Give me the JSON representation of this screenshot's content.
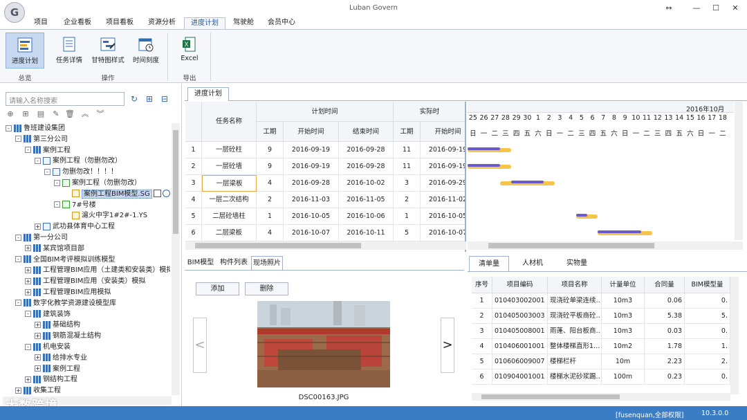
{
  "window": {
    "title": "Luban Govern",
    "logo": "G"
  },
  "menus": [
    "项目",
    "企业看板",
    "项目看板",
    "资源分析",
    "进度计划",
    "驾驶舱",
    "会员中心"
  ],
  "ribbon": {
    "buttons": [
      "进度计划",
      "任务详情",
      "甘特图样式",
      "时间刻度",
      "Excel"
    ],
    "groups": [
      "总览",
      "操作",
      "导出"
    ]
  },
  "left": {
    "search_placeholder": "请输入名称搜索",
    "tree": [
      {
        "label": "鲁班建设集团",
        "level": 0,
        "icon": "org",
        "expand": "-"
      },
      {
        "label": "第三分公司",
        "level": 1,
        "icon": "org",
        "expand": "-"
      },
      {
        "label": "案例工程",
        "level": 2,
        "icon": "org",
        "expand": "-"
      },
      {
        "label": "案例工程（勿删勿改）",
        "level": 3,
        "icon": "doc",
        "expand": "-"
      },
      {
        "label": "勿删勿改！！！！",
        "level": 4,
        "icon": "doc",
        "expand": "-"
      },
      {
        "label": "案例工程（勿删勿改）",
        "level": 5,
        "icon": "prj",
        "expand": "-"
      },
      {
        "label": "案例工程BIM模型.SG",
        "level": 6,
        "icon": "file",
        "expand": "",
        "selected": true
      },
      {
        "label": "7#号楼",
        "level": 5,
        "icon": "prj",
        "expand": "-"
      },
      {
        "label": "滬火中字1#2#-1.YS",
        "level": 6,
        "icon": "file",
        "expand": ""
      },
      {
        "label": "武功县体育中心工程",
        "level": 3,
        "icon": "doc",
        "expand": "+"
      },
      {
        "label": "第一分公司",
        "level": 1,
        "icon": "org",
        "expand": "-"
      },
      {
        "label": "某宾馆项目部",
        "level": 2,
        "icon": "org",
        "expand": "+"
      },
      {
        "label": "全国BIM考评模拟训练模型",
        "level": 1,
        "icon": "org",
        "expand": "-"
      },
      {
        "label": "工程管理BIM应用（土建类和安装类）模拟",
        "level": 2,
        "icon": "org",
        "expand": "+"
      },
      {
        "label": "工程管理BIM应用（安装类）模拟",
        "level": 2,
        "icon": "org",
        "expand": "+"
      },
      {
        "label": "工程管理BIM应用模拟",
        "level": 2,
        "icon": "org",
        "expand": "+"
      },
      {
        "label": "数字化教学资源建设模型库",
        "level": 1,
        "icon": "org",
        "expand": "-"
      },
      {
        "label": "建筑装饰",
        "level": 2,
        "icon": "org",
        "expand": "-"
      },
      {
        "label": "基础结构",
        "level": 3,
        "icon": "org",
        "expand": "+"
      },
      {
        "label": "钢筋混凝土结构",
        "level": 3,
        "icon": "org",
        "expand": "+"
      },
      {
        "label": "机电安装",
        "level": 2,
        "icon": "org",
        "expand": "-"
      },
      {
        "label": "给排水专业",
        "level": 3,
        "icon": "org",
        "expand": "+"
      },
      {
        "label": "案例工程",
        "level": 3,
        "icon": "org",
        "expand": "+"
      },
      {
        "label": "钢结构工程",
        "level": 2,
        "icon": "org",
        "expand": "+"
      },
      {
        "label": "收集工程",
        "level": 1,
        "icon": "org",
        "expand": "+"
      }
    ],
    "watermark": "大数跨境"
  },
  "schedule": {
    "tab": "进度计划",
    "headers": {
      "name": "任务名称",
      "plan": "计划时间",
      "actual": "实际时",
      "duration": "工期",
      "start": "开始时间",
      "end": "结束时间"
    },
    "rows": [
      {
        "no": "1",
        "name": "一层砼柱",
        "dur": "9",
        "start": "2016-09-19",
        "end": "2016-09-28",
        "adur": "11",
        "astart": "2016-09-19"
      },
      {
        "no": "2",
        "name": "一层砼墙",
        "dur": "9",
        "start": "2016-09-19",
        "end": "2016-09-28",
        "adur": "11",
        "astart": "2016-09-19"
      },
      {
        "no": "3",
        "name": "一层梁板",
        "dur": "4",
        "start": "2016-09-28",
        "end": "2016-10-02",
        "adur": "3",
        "astart": "2016-09-29"
      },
      {
        "no": "4",
        "name": "一层二次结构",
        "dur": "2",
        "start": "2016-11-03",
        "end": "2016-11-05",
        "adur": "2",
        "astart": "2016-11-02"
      },
      {
        "no": "5",
        "name": "二层砼墙柱",
        "dur": "1",
        "start": "2016-10-05",
        "end": "2016-10-06",
        "adur": "1",
        "astart": "2016-10-05"
      },
      {
        "no": "6",
        "name": "二层梁板",
        "dur": "4",
        "start": "2016-10-07",
        "end": "2016-10-11",
        "adur": "5",
        "astart": "2016-10-07"
      }
    ],
    "gantt_month": "2016年10月",
    "days": [
      "25",
      "26",
      "27",
      "28",
      "29",
      "30",
      "1",
      "2",
      "3",
      "4",
      "5",
      "6",
      "7",
      "8",
      "9",
      "10",
      "11",
      "12",
      "13",
      "14",
      "15",
      "16",
      "17",
      "18"
    ],
    "weekdays": [
      "日",
      "一",
      "二",
      "三",
      "四",
      "五",
      "六",
      "日",
      "一",
      "二",
      "三",
      "四",
      "五",
      "六",
      "日",
      "一",
      "二",
      "三",
      "四",
      "五",
      "六",
      "日",
      "一",
      "二"
    ]
  },
  "bottom_left": {
    "tabs": [
      "BIM模型",
      "构件列表",
      "现场照片"
    ],
    "add": "添加",
    "delete": "删除",
    "photo_name": "DSC00163.JPG"
  },
  "bottom_right": {
    "tabs": [
      "清单量",
      "人材机",
      "实物量"
    ],
    "columns": [
      "序号",
      "项目编码",
      "项目名称",
      "计量单位",
      "合同量",
      "BIM模型量"
    ],
    "rows": [
      [
        "1",
        "010403002001",
        "现浇砼单梁连续…",
        "10m3",
        "0.06",
        "0."
      ],
      [
        "2",
        "010405003003",
        "现浇砼平板商砼…",
        "10m3",
        "5.38",
        "5."
      ],
      [
        "3",
        "010405008001",
        "雨蓬、阳台板商…",
        "10m3",
        "0.03",
        "0."
      ],
      [
        "4",
        "010406001001",
        "整体楼梯直形1…",
        "10m2",
        "1.78",
        "1."
      ],
      [
        "5",
        "010606009007",
        "楼梯栏杆",
        "10m",
        "2.23",
        "2."
      ],
      [
        "6",
        "010904001001",
        "楼梯水泥砂浆踢…",
        "100m",
        "0.23",
        "0."
      ]
    ]
  },
  "status": {
    "user": "[fusenquan,全部权限]",
    "version": "10.3.0.0"
  }
}
